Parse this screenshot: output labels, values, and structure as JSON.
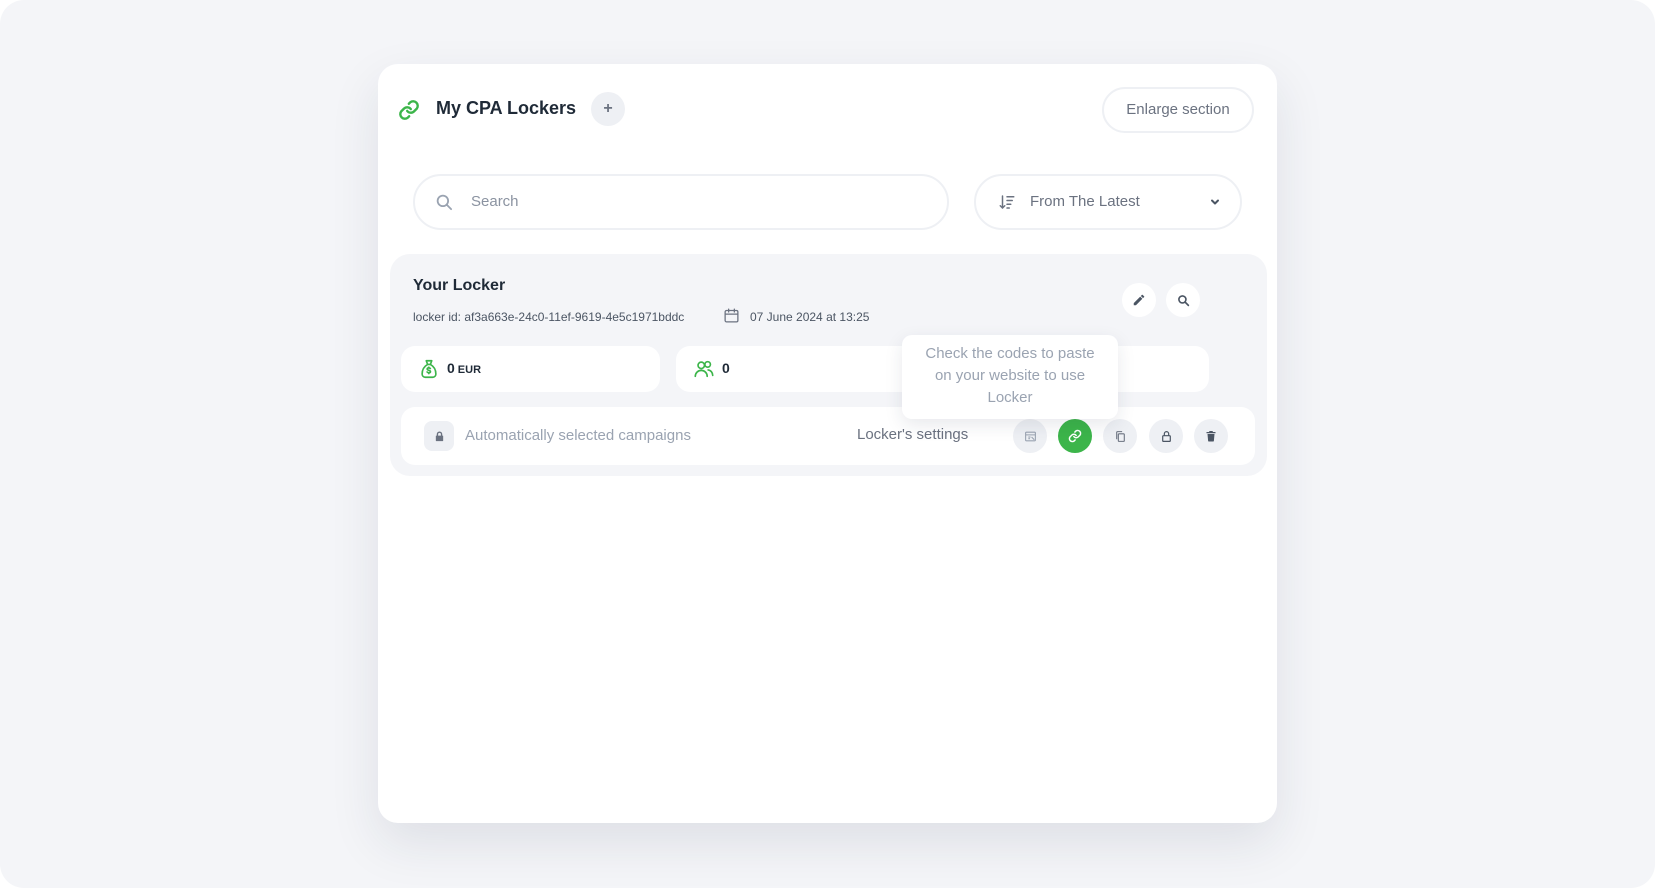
{
  "header": {
    "title": "My CPA Lockers",
    "add_label": "+",
    "enlarge_label": "Enlarge section",
    "link_icon": "link-icon",
    "accent": "#3cb54a"
  },
  "filters": {
    "search_placeholder": "Search",
    "sort_label": "From The Latest"
  },
  "locker": {
    "name": "Your Locker",
    "id_text": "locker id: af3a663e-24c0-11ef-9619-4e5c1971bddc",
    "date": "07 June 2024 at 13:25",
    "earnings_value": "0",
    "earnings_unit": "EUR",
    "visitors_value": "0",
    "campaigns_label": "Automatically selected campaigns",
    "settings_label": "Locker's settings",
    "actions": [
      "preview-icon",
      "link-icon",
      "copy-icon",
      "lock-icon",
      "trash-icon"
    ]
  },
  "tooltip": {
    "text": "Check the codes to paste on your website to use Locker"
  }
}
